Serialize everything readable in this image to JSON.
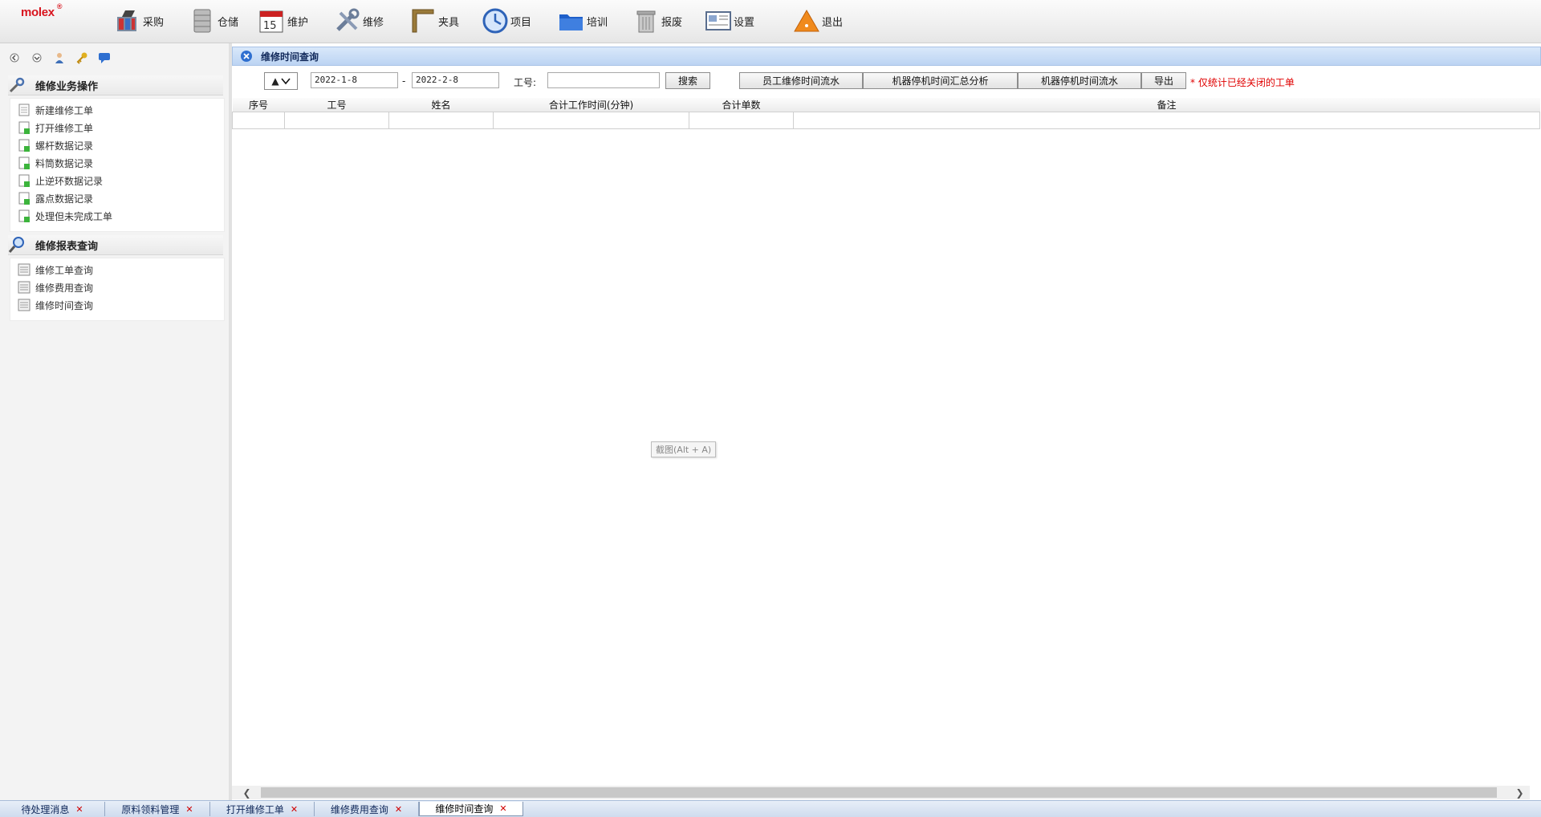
{
  "app": {
    "logo": "molex",
    "logo_mark": "®"
  },
  "toolbar": {
    "items": [
      {
        "label": "采购",
        "icon": "purchase-icon"
      },
      {
        "label": "仓储",
        "icon": "storage-icon"
      },
      {
        "label": "维护",
        "icon": "calendar-icon"
      },
      {
        "label": "维修",
        "icon": "tools-icon"
      },
      {
        "label": "夹具",
        "icon": "fixture-icon"
      },
      {
        "label": "项目",
        "icon": "project-clock-icon"
      },
      {
        "label": "培训",
        "icon": "folder-icon"
      },
      {
        "label": "报废",
        "icon": "trash-icon"
      },
      {
        "label": "设置",
        "icon": "settings-icon"
      },
      {
        "label": "退出",
        "icon": "warning-exit-icon"
      }
    ]
  },
  "sidebar": {
    "sections": [
      {
        "title": "维修业务操作",
        "items": [
          {
            "label": "新建维修工单"
          },
          {
            "label": "打开维修工单"
          },
          {
            "label": "螺杆数据记录"
          },
          {
            "label": "料筒数据记录"
          },
          {
            "label": "止逆环数据记录"
          },
          {
            "label": "露点数据记录"
          },
          {
            "label": "处理但未完成工单"
          }
        ]
      },
      {
        "title": "维修报表查询",
        "items": [
          {
            "label": "维修工单查询"
          },
          {
            "label": "维修费用查询"
          },
          {
            "label": "维修时间查询"
          }
        ]
      }
    ]
  },
  "panel": {
    "title": "维修时间查询",
    "date_from": "2022-1-8",
    "date_sep": "-",
    "date_to": "2022-2-8",
    "emp_label": "工号:",
    "emp_value": "",
    "search_label": "搜索",
    "buttons": [
      "员工维修时间流水",
      "机器停机时间汇总分析",
      "机器停机时间流水",
      "导出"
    ],
    "note": "* 仅统计已经关闭的工单"
  },
  "grid": {
    "columns": [
      "序号",
      "工号",
      "姓名",
      "合计工作时间(分钟)",
      "合计单数",
      "备注"
    ]
  },
  "tooltip": "截图(Alt + A)",
  "tabs": [
    {
      "label": "待处理消息",
      "active": false
    },
    {
      "label": "原料领料管理",
      "active": false
    },
    {
      "label": "打开维修工单",
      "active": false
    },
    {
      "label": "维修费用查询",
      "active": false
    },
    {
      "label": "维修时间查询",
      "active": true
    }
  ],
  "colors": {
    "brand": "#d8141e",
    "note": "#e00000",
    "title_bar": "#bcd4f3"
  }
}
